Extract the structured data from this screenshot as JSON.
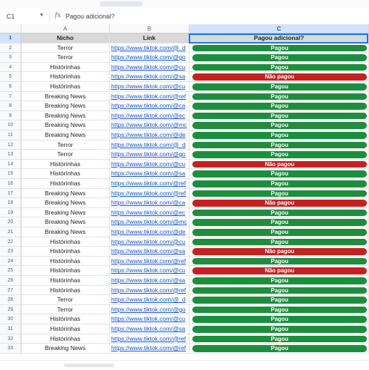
{
  "formula_bar": {
    "cell_ref": "C1",
    "fx_label": "fx",
    "value": "Pagou adicional?"
  },
  "column_headers": [
    "A",
    "B",
    "C"
  ],
  "header_row": {
    "row_number": "1",
    "a": "Nicho",
    "b": "Link",
    "c": "Pagou adicional?"
  },
  "colors": {
    "paid": "#1e8e3e",
    "not_paid": "#c5221f",
    "selection": "#1a73e8"
  },
  "rows": [
    {
      "n": "2",
      "a": "Terror",
      "b": "https://www.tiktok.com/@_d",
      "c": "Pagou",
      "paid": true
    },
    {
      "n": "3",
      "a": "Terror",
      "b": "https://www.tiktok.com/@go",
      "c": "Pagou",
      "paid": true
    },
    {
      "n": "4",
      "a": "Histórinhas",
      "b": "https://www.tiktok.com/@cu",
      "c": "Pagou",
      "paid": true
    },
    {
      "n": "5",
      "a": "Histórinhas",
      "b": "https://www.tiktok.com/@sa",
      "c": "Não pagou",
      "paid": false
    },
    {
      "n": "6",
      "a": "Histórinhas",
      "b": "https://www.tiktok.com/@cu",
      "c": "Pagou",
      "paid": true
    },
    {
      "n": "7",
      "a": "Breaking News",
      "b": "https://www.tiktok.com/@ref",
      "c": "Pagou",
      "paid": true
    },
    {
      "n": "8",
      "a": "Breaking News",
      "b": "https://www.tiktok.com/@ca",
      "c": "Pagou",
      "paid": true
    },
    {
      "n": "9",
      "a": "Breaking News",
      "b": "https://www.tiktok.com/@ec",
      "c": "Pagou",
      "paid": true
    },
    {
      "n": "10",
      "a": "Breaking News",
      "b": "https://www.tiktok.com/@mc",
      "c": "Pagou",
      "paid": true
    },
    {
      "n": "11",
      "a": "Breaking News",
      "b": "https://www.tiktok.com/@de",
      "c": "Pagou",
      "paid": true
    },
    {
      "n": "12",
      "a": "Terror",
      "b": "https://www.tiktok.com/@_d",
      "c": "Pagou",
      "paid": true
    },
    {
      "n": "13",
      "a": "Terror",
      "b": "https://www.tiktok.com/@go",
      "c": "Pagou",
      "paid": true
    },
    {
      "n": "14",
      "a": "Histórinhas",
      "b": "https://www.tiktok.com/@cu",
      "c": "Não pagou",
      "paid": false
    },
    {
      "n": "15",
      "a": "Histórinhas",
      "b": "https://www.tiktok.com/@sa",
      "c": "Pagou",
      "paid": true
    },
    {
      "n": "16",
      "a": "Histórinhas",
      "b": "https://www.tiktok.com/@ref",
      "c": "Pagou",
      "paid": true
    },
    {
      "n": "17",
      "a": "Breaking News",
      "b": "https://www.tiktok.com/@ref",
      "c": "Pagou",
      "paid": true
    },
    {
      "n": "18",
      "a": "Breaking News",
      "b": "https://www.tiktok.com/@ca",
      "c": "Não pagou",
      "paid": false
    },
    {
      "n": "19",
      "a": "Breaking News",
      "b": "https://www.tiktok.com/@ec",
      "c": "Pagou",
      "paid": true
    },
    {
      "n": "20",
      "a": "Breaking News",
      "b": "https://www.tiktok.com/@mc",
      "c": "Pagou",
      "paid": true
    },
    {
      "n": "21",
      "a": "Breaking News",
      "b": "https://www.tiktok.com/@de",
      "c": "Pagou",
      "paid": true
    },
    {
      "n": "22",
      "a": "Histórinhas",
      "b": "https://www.tiktok.com/@cu",
      "c": "Pagou",
      "paid": true
    },
    {
      "n": "23",
      "a": "Histórinhas",
      "b": "https://www.tiktok.com/@sa",
      "c": "Não pagou",
      "paid": false
    },
    {
      "n": "24",
      "a": "Histórinhas",
      "b": "https://www.tiktok.com/@ref",
      "c": "Pagou",
      "paid": true
    },
    {
      "n": "25",
      "a": "Histórinhas",
      "b": "https://www.tiktok.com/@cu",
      "c": "Não pagou",
      "paid": false
    },
    {
      "n": "26",
      "a": "Histórinhas",
      "b": "https://www.tiktok.com/@sa",
      "c": "Pagou",
      "paid": true
    },
    {
      "n": "27",
      "a": "Histórinhas",
      "b": "https://www.tiktok.com/@ref",
      "c": "Pagou",
      "paid": true
    },
    {
      "n": "28",
      "a": "Terror",
      "b": "https://www.tiktok.com/@_d",
      "c": "Pagou",
      "paid": true
    },
    {
      "n": "29",
      "a": "Terror",
      "b": "https://www.tiktok.com/@go",
      "c": "Pagou",
      "paid": true
    },
    {
      "n": "30",
      "a": "Histórinhas",
      "b": "https://www.tiktok.com/@cu",
      "c": "Pagou",
      "paid": true
    },
    {
      "n": "31",
      "a": "Histórinhas",
      "b": "https://www.tiktok.com/@sa",
      "c": "Pagou",
      "paid": true
    },
    {
      "n": "32",
      "a": "Histórinhas",
      "b": "https://www.tiktok.com/@ref",
      "c": "Pagou",
      "paid": true
    },
    {
      "n": "33",
      "a": "Breaking News",
      "b": "https://www.tiktok.com/@ref",
      "c": "Pagou",
      "paid": true
    }
  ]
}
